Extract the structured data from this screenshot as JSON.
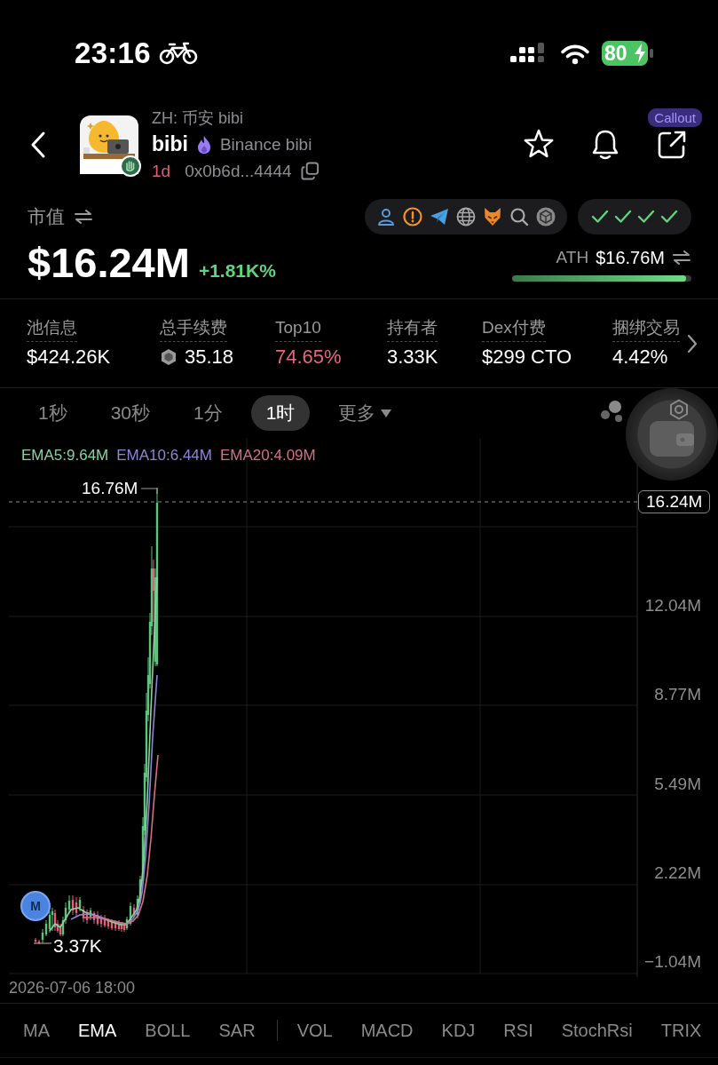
{
  "status_bar": {
    "time": "23:16",
    "battery": "80"
  },
  "token": {
    "alias": "ZH: 币安 bibi",
    "symbol": "bibi",
    "name": "Binance bibi",
    "age": "1d",
    "address": "0x0b6d...4444",
    "callout": "Callout"
  },
  "market_cap": {
    "label": "市值",
    "value": "$16.24M",
    "change": "+1.81K%",
    "audit_checks": [
      {
        "passed": true
      },
      {
        "passed": true
      },
      {
        "passed": true
      },
      {
        "passed": true
      }
    ],
    "ath_label": "ATH",
    "ath_value": "$16.76M",
    "ath_bar": {
      "level": 0.97
    }
  },
  "stats": [
    {
      "label": "池信息",
      "value": "$424.26K",
      "kind": "plain",
      "warning": false
    },
    {
      "label": "总手续费",
      "value": "35.18",
      "kind": "coin",
      "warning": false
    },
    {
      "label": "Top10",
      "value": "74.65%",
      "kind": "plain",
      "warning": true
    },
    {
      "label": "持有者",
      "value": "3.33K",
      "kind": "plain",
      "warning": false
    },
    {
      "label": "Dex付费",
      "value": "$299 CTO",
      "kind": "plain",
      "warning": false
    },
    {
      "label": "捆绑交易",
      "value": "4.42%",
      "kind": "plain",
      "warning": false
    }
  ],
  "timeframes": [
    {
      "label": "1秒",
      "kind": "tab",
      "selected": false
    },
    {
      "label": "30秒",
      "kind": "tab",
      "selected": false
    },
    {
      "label": "1分",
      "kind": "tab",
      "selected": false
    },
    {
      "label": "1时",
      "kind": "tab",
      "selected": true
    },
    {
      "label": "更多",
      "kind": "dropdown",
      "selected": false
    }
  ],
  "chart": {
    "ema_legend": [
      {
        "label": "EMA5:9.64M",
        "color": "#86d49c"
      },
      {
        "label": "EMA10:6.44M",
        "color": "#8f85d6"
      },
      {
        "label": "EMA20:4.09M",
        "color": "#d4717f"
      }
    ],
    "high_label": "16.76M",
    "current_price": "16.24M",
    "y_axis_labels": [
      "12.04M",
      "8.77M",
      "5.49M",
      "2.22M",
      "−1.04M"
    ],
    "marker": "M",
    "low_label": "3.37K",
    "time_label": "2026-07-06 18:00"
  },
  "indicators": [
    {
      "label": "MA",
      "divider_before": false,
      "selected": false
    },
    {
      "label": "EMA",
      "divider_before": false,
      "selected": true
    },
    {
      "label": "BOLL",
      "divider_before": false,
      "selected": false
    },
    {
      "label": "SAR",
      "divider_before": false,
      "selected": false
    },
    {
      "label": "VOL",
      "divider_before": true,
      "selected": false
    },
    {
      "label": "MACD",
      "divider_before": false,
      "selected": false
    },
    {
      "label": "KDJ",
      "divider_before": false,
      "selected": false
    },
    {
      "label": "RSI",
      "divider_before": false,
      "selected": false
    },
    {
      "label": "StochRsi",
      "divider_before": false,
      "selected": false
    },
    {
      "label": "TRIX",
      "divider_before": false,
      "selected": false
    }
  ]
}
